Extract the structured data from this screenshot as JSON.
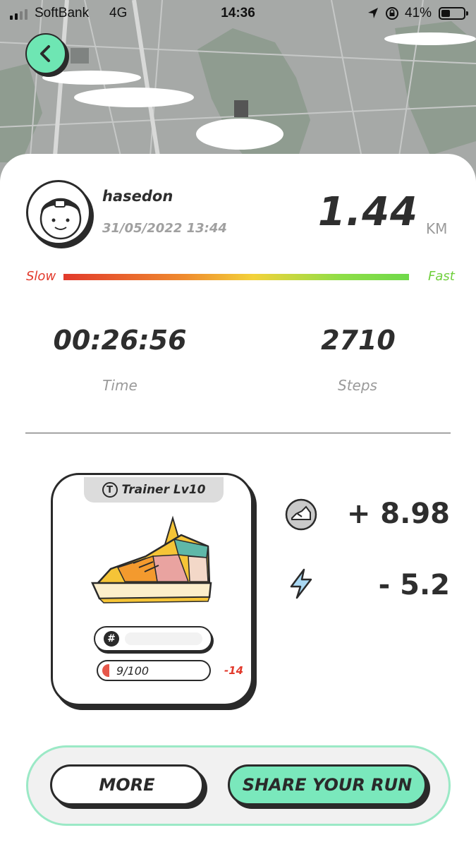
{
  "status_bar": {
    "carrier": "SoftBank",
    "network": "4G",
    "time": "14:36",
    "battery_percent": "41%",
    "battery_level": 0.41
  },
  "map": {
    "back_icon": "chevron-left-icon"
  },
  "run": {
    "username": "hasedon",
    "datetime": "31/05/2022 13:44",
    "distance": "1.44",
    "distance_unit": "KM",
    "speed_slow_label": "Slow",
    "speed_fast_label": "Fast",
    "time_value": "00:26:56",
    "time_label": "Time",
    "steps_value": "2710",
    "steps_label": "Steps"
  },
  "sneaker": {
    "type_icon_letter": "T",
    "type_label": "Trainer Lv10",
    "durability": "9/100",
    "durability_level": 0.09,
    "durability_change": "-14"
  },
  "rewards": {
    "gst_icon": "sneaker-coin-icon",
    "gst_value": "+ 8.98",
    "energy_icon": "lightning-icon",
    "energy_value": "- 5.2"
  },
  "actions": {
    "more_label": "MORE",
    "share_label": "SHARE YOUR RUN"
  },
  "colors": {
    "accent": "#6ee6b3",
    "slow": "#e23a2c",
    "fast": "#6fcf3c"
  }
}
